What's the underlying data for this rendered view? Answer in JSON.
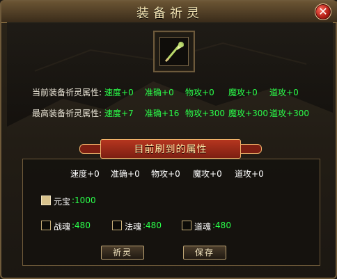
{
  "window": {
    "title": "装备祈灵"
  },
  "equipment": {
    "current_label": "当前装备祈灵属性:",
    "max_label": "最高装备祈灵属性:",
    "current": [
      {
        "name": "速度",
        "value": "+0"
      },
      {
        "name": "准确",
        "value": "+0"
      },
      {
        "name": "物攻",
        "value": "+0"
      },
      {
        "name": "魔攻",
        "value": "+0"
      },
      {
        "name": "道攻",
        "value": "+0"
      }
    ],
    "max": [
      {
        "name": "速度",
        "value": "+7"
      },
      {
        "name": "准确",
        "value": "+16"
      },
      {
        "name": "物攻",
        "value": "+300"
      },
      {
        "name": "魔攻",
        "value": "+300"
      },
      {
        "name": "道攻",
        "value": "+300"
      }
    ]
  },
  "refresh": {
    "header": "目前刷到的属性",
    "attributes": [
      {
        "name": "速度",
        "value": "+0"
      },
      {
        "name": "准确",
        "value": "+0"
      },
      {
        "name": "物攻",
        "value": "+0"
      },
      {
        "name": "魔攻",
        "value": "+0"
      },
      {
        "name": "道攻",
        "value": "+0"
      }
    ]
  },
  "options": {
    "yuanbao": {
      "label": "元宝",
      "value": ":1000",
      "checked": true
    },
    "zhanhun": {
      "label": "战魂",
      "value": ":480",
      "checked": false
    },
    "fahun": {
      "label": "法魂",
      "value": ":480",
      "checked": false
    },
    "daohun": {
      "label": "道魂",
      "value": ":480",
      "checked": false
    }
  },
  "buttons": {
    "qiling": "祈灵",
    "save": "保存"
  },
  "icons": {
    "close": "close-icon",
    "equipment": "staff-icon"
  },
  "colors": {
    "green": "#2aff4a",
    "banner_red": "#b11d14",
    "gold": "#f2e3b2"
  }
}
